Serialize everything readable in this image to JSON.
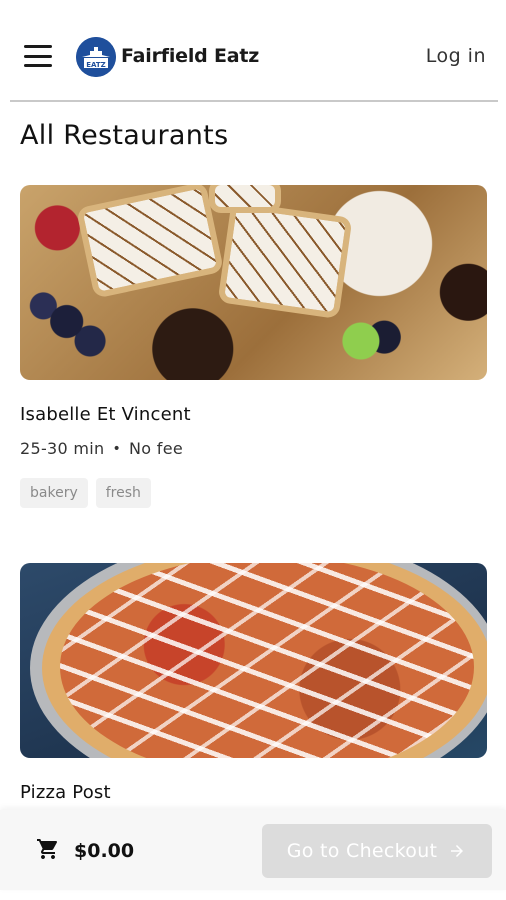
{
  "header": {
    "brand": "Fairfield Eatz",
    "login_label": "Log in",
    "menu_icon": "hamburger-menu-icon",
    "logo_icon": "fairfield-eatz-logo",
    "logo_text": "EATZ"
  },
  "page": {
    "title": "All Restaurants"
  },
  "restaurants": [
    {
      "name": "Isabelle Et Vincent",
      "time": "25-30 min",
      "fee": "No fee",
      "tags": [
        "bakery",
        "fresh"
      ],
      "image": "bakery-pastries"
    },
    {
      "name": "Pizza Post",
      "image": "pizza"
    }
  ],
  "cart": {
    "icon": "cart-icon",
    "total": "$0.00",
    "checkout_label": "Go to Checkout",
    "checkout_icon": "arrow-right-icon"
  },
  "colors": {
    "logo_blue": "#1f4f9c",
    "checkout_disabled": "#dcdcdc",
    "tag_bg": "#f1f1f1"
  }
}
